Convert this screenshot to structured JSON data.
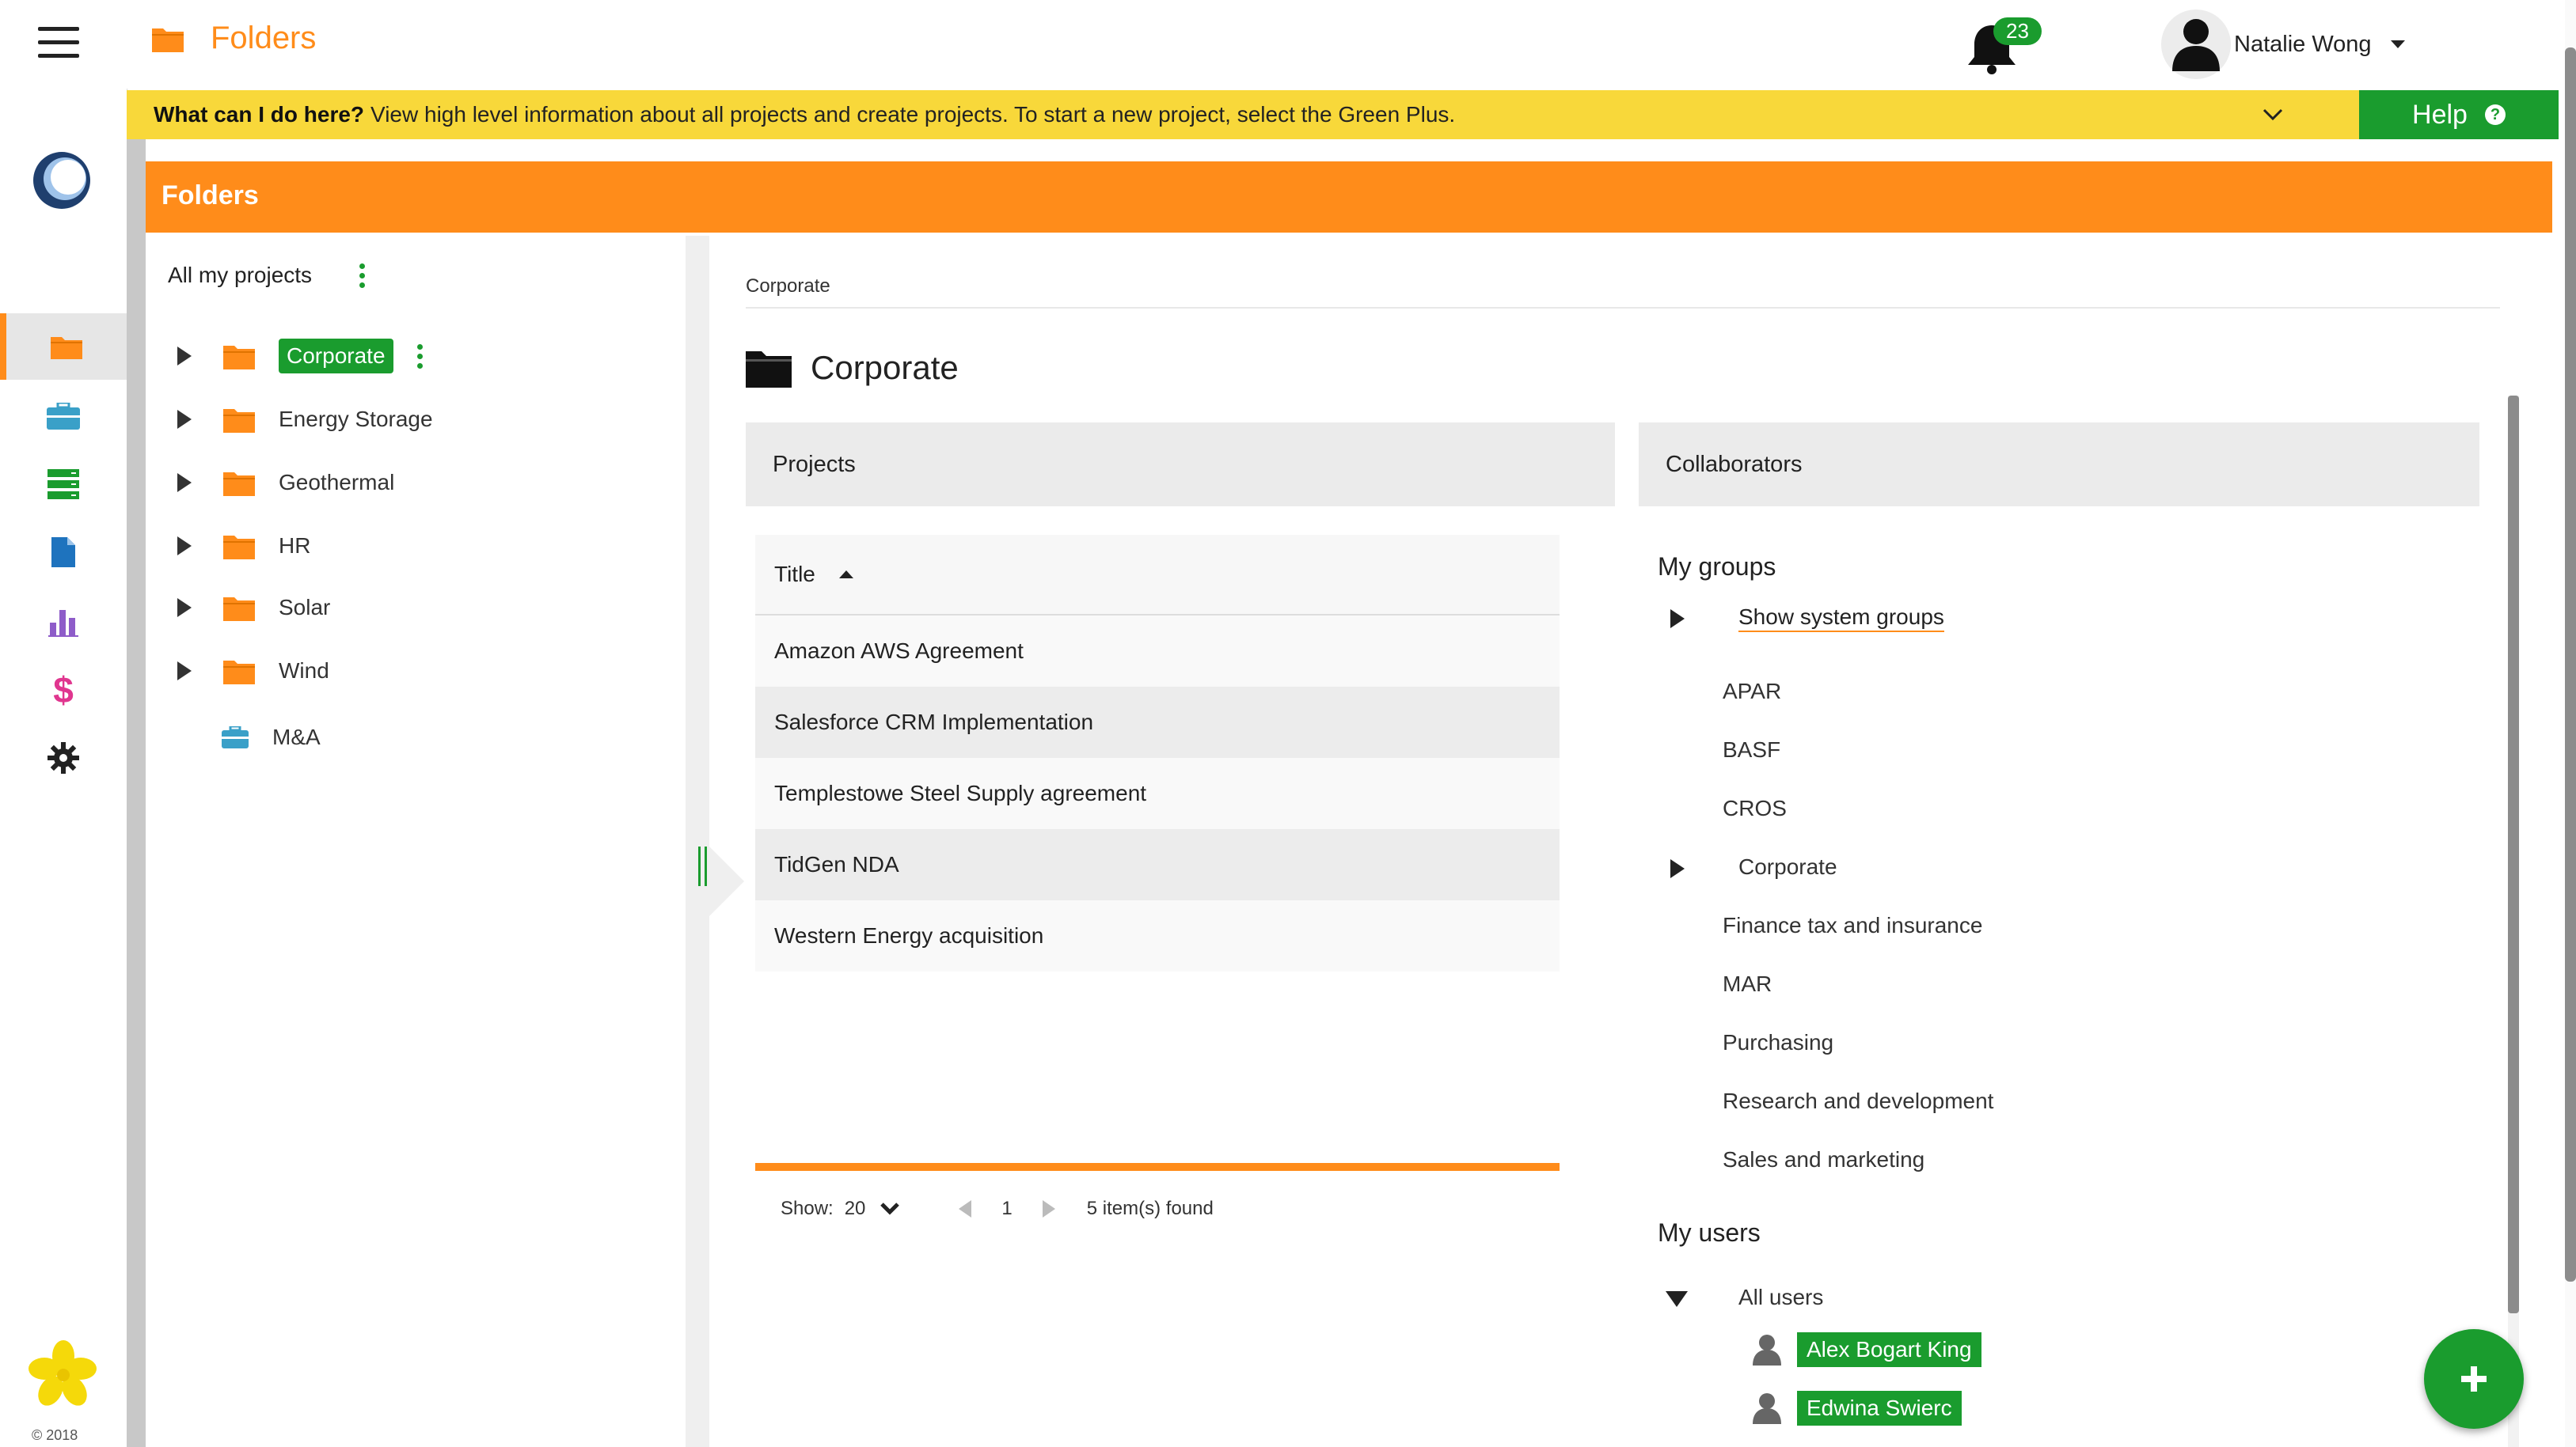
{
  "app": {
    "title": "Folders",
    "copyright": "© 2018"
  },
  "notifications": {
    "count": "23"
  },
  "user": {
    "name": "Natalie Wong"
  },
  "banner": {
    "question": "What can I do here?",
    "text": "View high level information about all projects and create projects. To start a new project, select the Green Plus."
  },
  "help": {
    "label": "Help"
  },
  "panel": {
    "title": "Folders"
  },
  "tree": {
    "header": "All my projects",
    "items": [
      {
        "label": "Corporate",
        "selected": true
      },
      {
        "label": "Energy Storage"
      },
      {
        "label": "Geothermal"
      },
      {
        "label": "HR"
      },
      {
        "label": "Solar"
      },
      {
        "label": "Wind"
      },
      {
        "label": "M&A"
      }
    ]
  },
  "content": {
    "breadcrumb": "Corporate",
    "title": "Corporate",
    "projects_tab": "Projects",
    "collaborators_tab": "Collaborators"
  },
  "projects_table": {
    "header": "Title",
    "rows": [
      "Amazon AWS Agreement",
      "Salesforce CRM Implementation",
      "Templestowe Steel Supply agreement",
      "TidGen NDA",
      "Western Energy acquisition"
    ],
    "show_label": "Show:",
    "page_size": "20",
    "page": "1",
    "found": "5 item(s) found"
  },
  "collaborators": {
    "groups_title": "My groups",
    "show_system": "Show system groups",
    "groups": [
      "APAR",
      "BASF",
      "CROS",
      "Corporate",
      "Finance tax and insurance",
      "MAR",
      "Purchasing",
      "Research and development",
      "Sales and marketing"
    ],
    "users_title": "My users",
    "all_users": "All users",
    "users": [
      "Alex Bogart King",
      "Edwina Swierc"
    ]
  },
  "colors": {
    "accent": "#ff8c1a",
    "green": "#1a9c2e",
    "banner": "#f8d83a"
  },
  "icons": [
    "menu-icon",
    "app-logo",
    "folder-icon",
    "briefcase-icon",
    "server-icon",
    "document-icon",
    "chart-icon",
    "dollar-icon",
    "gear-icon",
    "bell-icon",
    "user-icon",
    "help-icon",
    "plus-icon"
  ]
}
